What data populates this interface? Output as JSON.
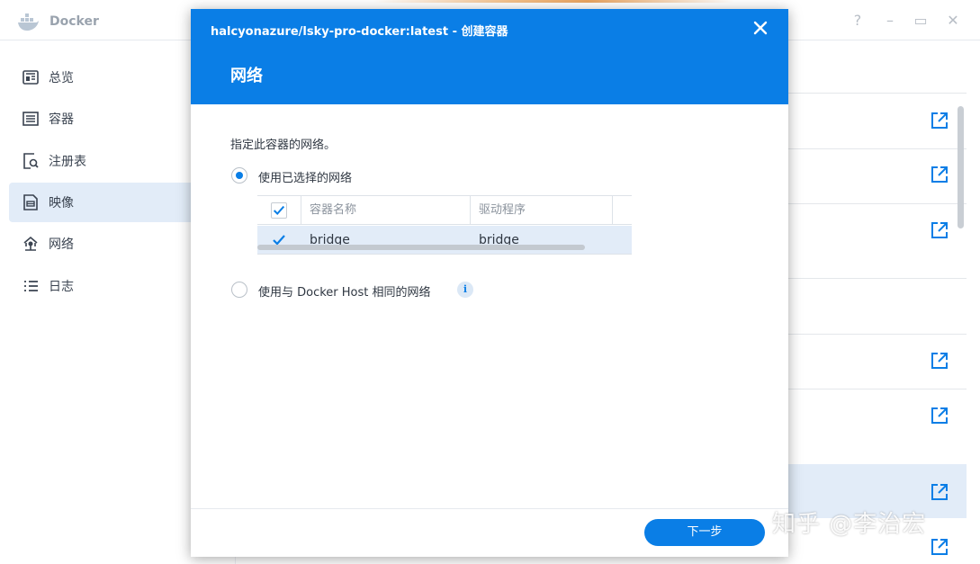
{
  "app": {
    "title": "Docker",
    "window_controls": [
      "?",
      "–",
      "▭",
      "✕"
    ]
  },
  "sidebar": {
    "items": [
      {
        "label": "总览",
        "icon": "overview-icon",
        "active": false
      },
      {
        "label": "容器",
        "icon": "container-icon",
        "active": false
      },
      {
        "label": "注册表",
        "icon": "registry-icon",
        "active": false
      },
      {
        "label": "映像",
        "icon": "image-icon",
        "active": true
      },
      {
        "label": "网络",
        "icon": "network-icon",
        "active": false
      },
      {
        "label": "日志",
        "icon": "log-icon",
        "active": false
      }
    ]
  },
  "modal": {
    "title": "halcyonazure/lsky-pro-docker:latest - 创建容器",
    "step_title": "网络",
    "description": "指定此容器的网络。",
    "option_selected": "使用已选择的网络",
    "option_host": "使用与 Docker Host 相同的网络",
    "table": {
      "headers": [
        "容器名称",
        "驱动程序"
      ],
      "rows": [
        {
          "name": "bridge",
          "driver": "bridge",
          "checked": true
        }
      ]
    },
    "next_button": "下一步"
  },
  "watermark": "知乎 @李治宏",
  "colors": {
    "accent": "#0a7ee6",
    "selection": "#e2ecf8"
  }
}
